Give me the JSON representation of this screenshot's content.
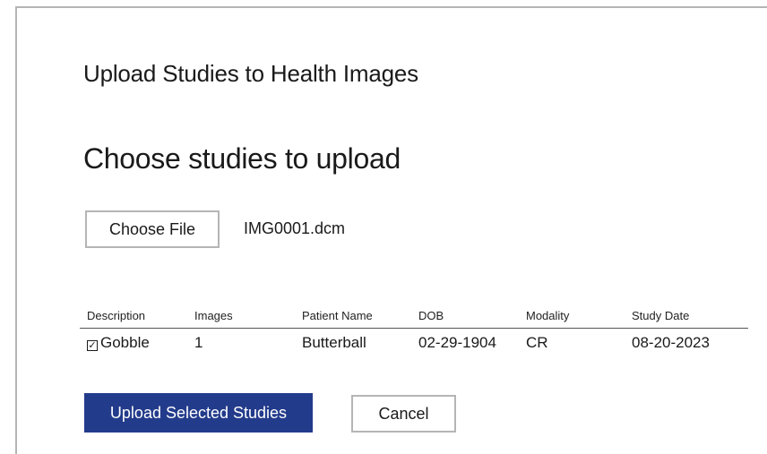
{
  "dialog": {
    "title": "Upload Studies to Health Images",
    "subtitle": "Choose studies to upload",
    "file_input": {
      "button_label": "Choose File",
      "selected_file": "IMG0001.dcm"
    },
    "table": {
      "columns": [
        "Description",
        "Images",
        "Patient Name",
        "DOB",
        "Modality",
        "Study Date"
      ],
      "rows": [
        {
          "selected": true,
          "checkbox_glyph": "✓",
          "description": "Gobble",
          "images": "1",
          "patient_name": "Butterball",
          "dob": "02-29-1904",
          "modality": "CR",
          "study_date": "08-20-2023"
        }
      ]
    },
    "actions": {
      "upload_label": "Upload Selected Studies",
      "cancel_label": "Cancel"
    }
  },
  "colors": {
    "primary": "#233b8b",
    "border": "#b5b5b5",
    "text": "#1a1a1a"
  }
}
